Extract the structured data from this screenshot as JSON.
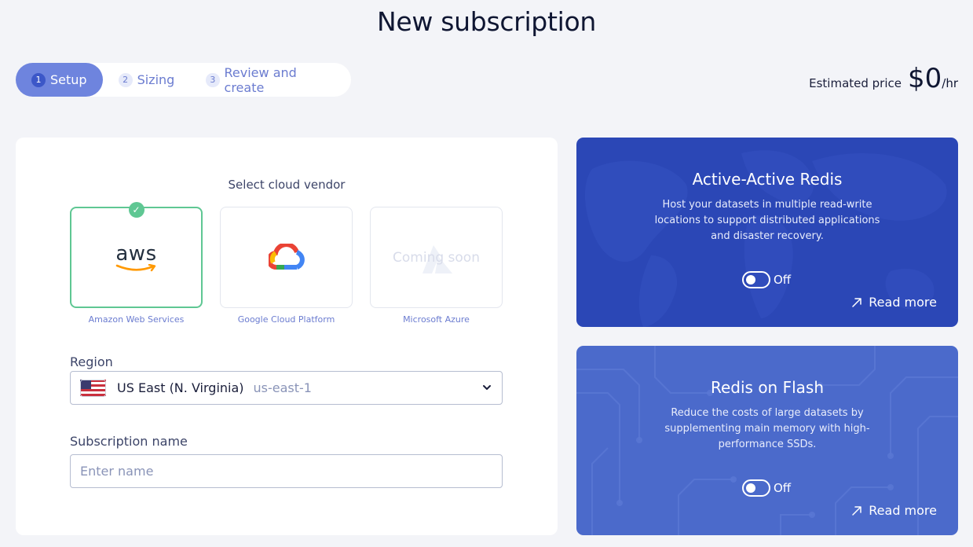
{
  "page": {
    "title": "New subscription"
  },
  "stepper": {
    "steps": [
      {
        "num": "1",
        "label": "Setup"
      },
      {
        "num": "2",
        "label": "Sizing"
      },
      {
        "num": "3",
        "label": "Review and create"
      }
    ],
    "active_step": "1"
  },
  "price": {
    "label": "Estimated price",
    "amount": "$0",
    "unit": "/hr"
  },
  "setup": {
    "vendor_title": "Select cloud vendor",
    "vendors": [
      {
        "name": "Amazon Web Services",
        "logo_text": "aws",
        "selected": true
      },
      {
        "name": "Google Cloud Platform",
        "logo_icon": "google-cloud-icon"
      },
      {
        "name": "Microsoft Azure",
        "overlay": "Coming soon"
      }
    ],
    "region": {
      "label": "Region",
      "name": "US East (N. Virginia)",
      "code": "us-east-1",
      "flag_icon": "us-flag-icon"
    },
    "subscription_name": {
      "label": "Subscription name",
      "value": "",
      "placeholder": "Enter name"
    }
  },
  "features": [
    {
      "title": "Active-Active Redis",
      "description": "Host your datasets in multiple read-write locations to support distributed applications and disaster recovery.",
      "toggle_state": "Off",
      "read_more": "Read more",
      "background": "world-map"
    },
    {
      "title": "Redis on Flash",
      "description": "Reduce the costs of large datasets by supplementing main memory with high-performance SSDs.",
      "toggle_state": "Off",
      "read_more": "Read more",
      "background": "circuit-board"
    }
  ],
  "colors": {
    "page_bg": "#f3f4f8",
    "step_active": "#6e84de",
    "selected_border": "#5fc793",
    "active_active_bg": "#2b47b6",
    "redis_on_flash_bg": "#4b6acb"
  }
}
